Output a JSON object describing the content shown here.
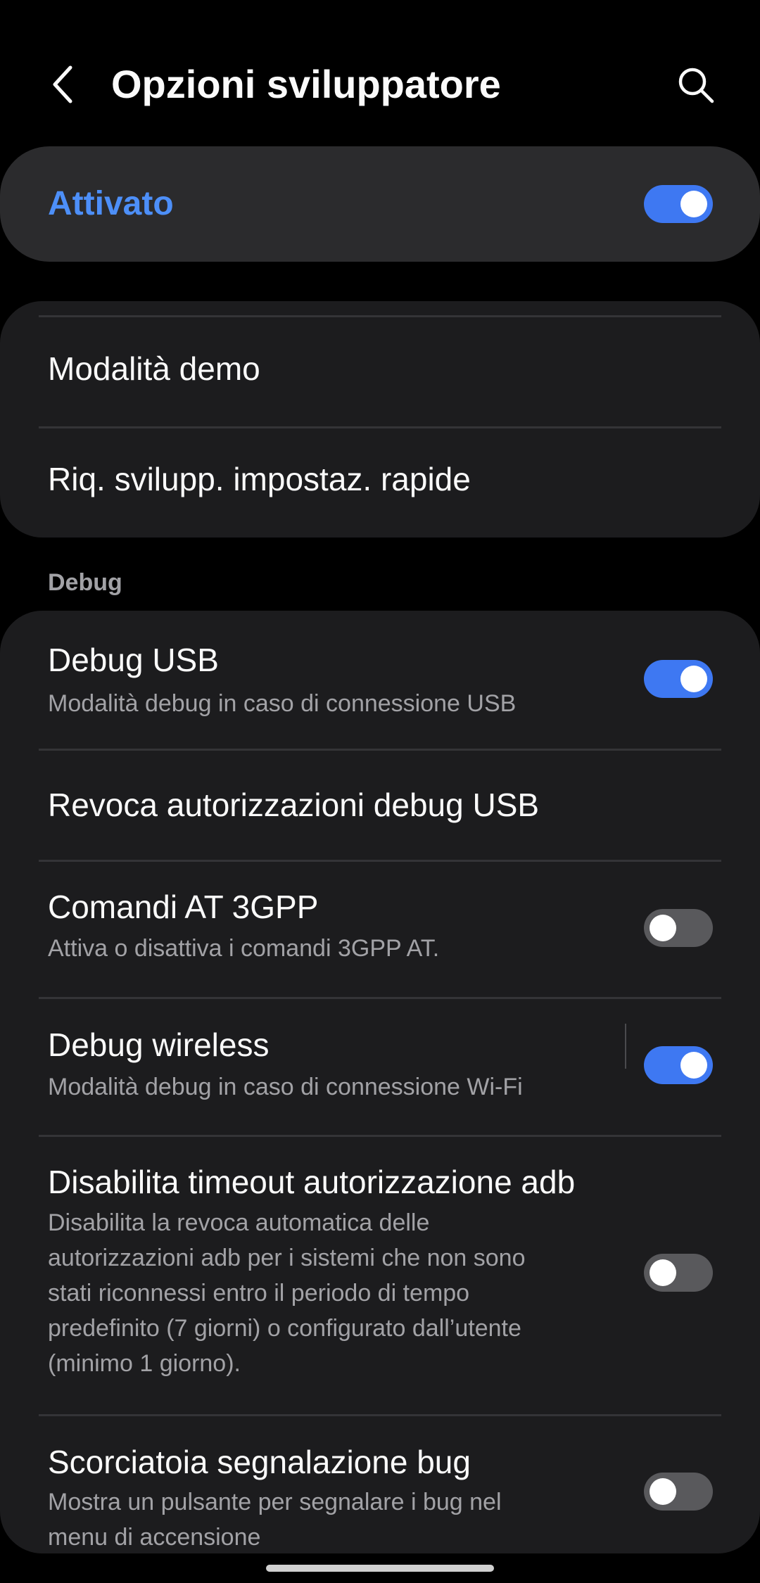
{
  "header": {
    "title": "Opzioni sviluppatore",
    "back_icon": "chevron-left-icon",
    "search_icon": "search-icon"
  },
  "master": {
    "label": "Attivato",
    "enabled": true
  },
  "top_group": {
    "items": [
      {
        "title": "Modalità demo"
      },
      {
        "title": "Riq. svilupp. impostaz. rapide"
      }
    ]
  },
  "debug_section": {
    "header": "Debug",
    "items": [
      {
        "title": "Debug USB",
        "subtitle": "Modalità debug in caso di connessione USB",
        "switch": true
      },
      {
        "title": "Revoca autorizzazioni debug USB"
      },
      {
        "title": "Comandi AT 3GPP",
        "subtitle": "Attiva o disattiva i comandi 3GPP AT.",
        "switch": false
      },
      {
        "title": "Debug wireless",
        "subtitle": "Modalità debug in caso di connessione Wi-Fi",
        "switch": true
      },
      {
        "title": "Disabilita timeout autorizzazione adb",
        "subtitle_lines": [
          "Disabilita la revoca automatica delle",
          "autorizzazioni adb per i sistemi che non sono",
          "stati riconnessi entro il periodo di tempo",
          "predefinito (7 giorni) o configurato dall’utente",
          "(minimo 1 giorno)."
        ],
        "switch": false
      },
      {
        "title": "Scorciatoia segnalazione bug",
        "subtitle_lines": [
          "Mostra un pulsante per segnalare i bug nel",
          "menu di accensione"
        ],
        "switch": false
      }
    ]
  },
  "colors": {
    "accent": "#4d8ff8",
    "switch_on": "#3e78f2",
    "switch_off": "#59595c",
    "card_bg": "#1c1c1e",
    "master_bg": "#2b2b2d"
  }
}
